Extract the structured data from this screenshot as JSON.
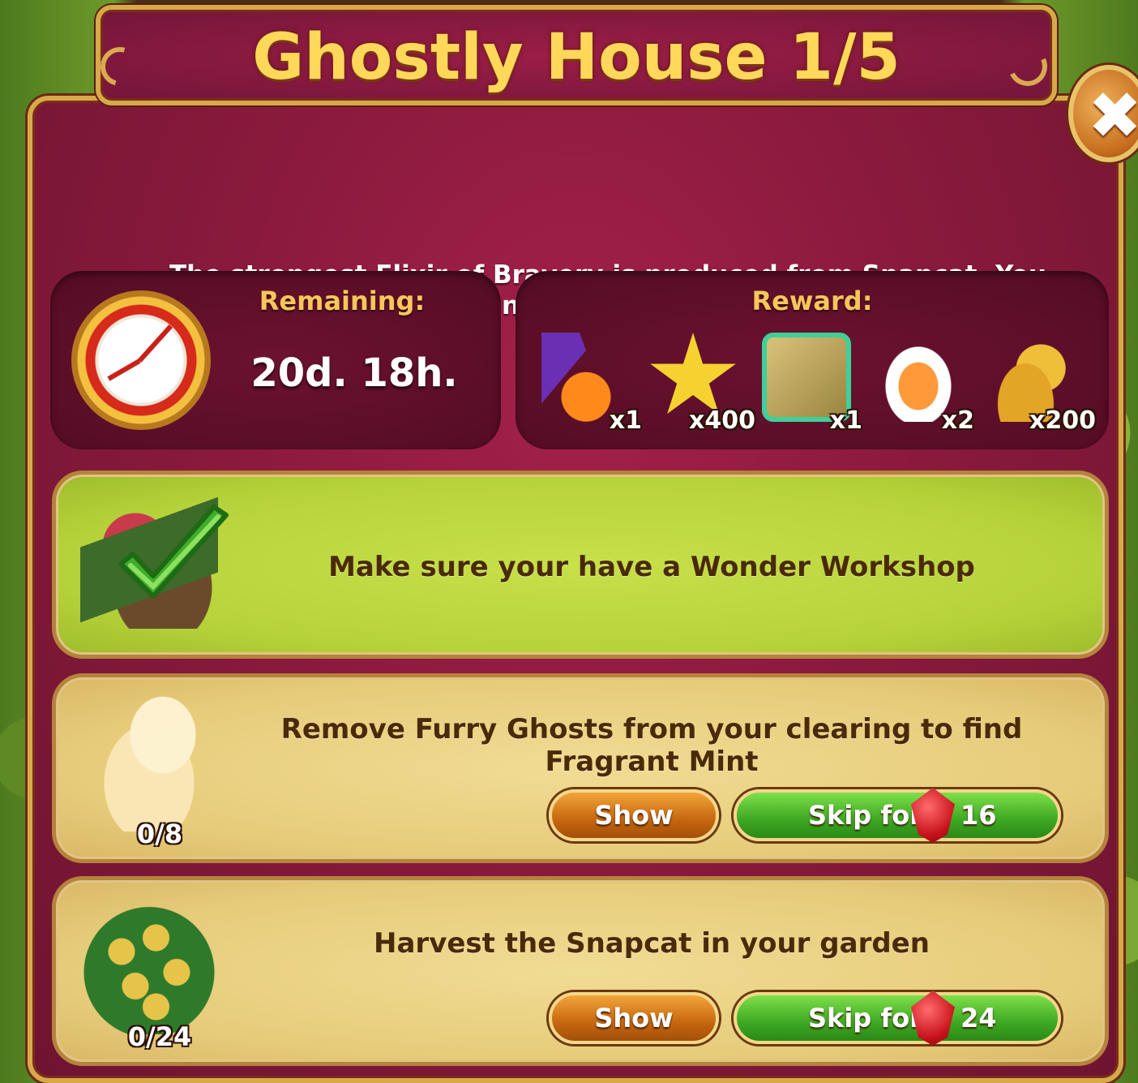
{
  "dialog": {
    "title": "Ghostly House 1/5",
    "description": "The strongest Elixir of Bravery is produced from Snapcat. You just need to find courage for its challenge!",
    "close_icon": "close-icon"
  },
  "remaining": {
    "label": "Remaining:",
    "value": "20d. 18h.",
    "icon": "clock-icon"
  },
  "reward": {
    "label": "Reward:",
    "items": [
      {
        "icon": "pumpkin-witch-hat-icon",
        "qty": "x1"
      },
      {
        "icon": "star-icon",
        "qty": "x400"
      },
      {
        "icon": "ghostly-scroll-icon",
        "qty": "x1"
      },
      {
        "icon": "elixir-potion-icon",
        "qty": "x2"
      },
      {
        "icon": "gold-coins-icon",
        "qty": "x200"
      }
    ]
  },
  "tasks": [
    {
      "text": "Make sure your have a Wonder Workshop",
      "status": "completed",
      "icon": "wonder-workshop-icon"
    },
    {
      "text": "Remove Furry Ghosts from your clearing to find Fragrant Mint",
      "progress": "0/8",
      "show_label": "Show",
      "skip_label": "Skip for",
      "skip_cost": "16",
      "icon": "furry-ghost-icon"
    },
    {
      "text": "Harvest the Snapcat in your garden",
      "progress": "0/24",
      "show_label": "Show",
      "skip_label": "Skip for",
      "skip_cost": "24",
      "icon": "snapcat-plant-icon"
    }
  ],
  "colors": {
    "panel": "#8a1a3d",
    "title": "#ffd85a",
    "label_gold": "#f7c65a",
    "done_green": "#c8e04a",
    "pending_tan": "#e6cb7a",
    "show_orange": "#c7670f",
    "skip_green": "#3ea823",
    "ruby": "#c8121c"
  }
}
